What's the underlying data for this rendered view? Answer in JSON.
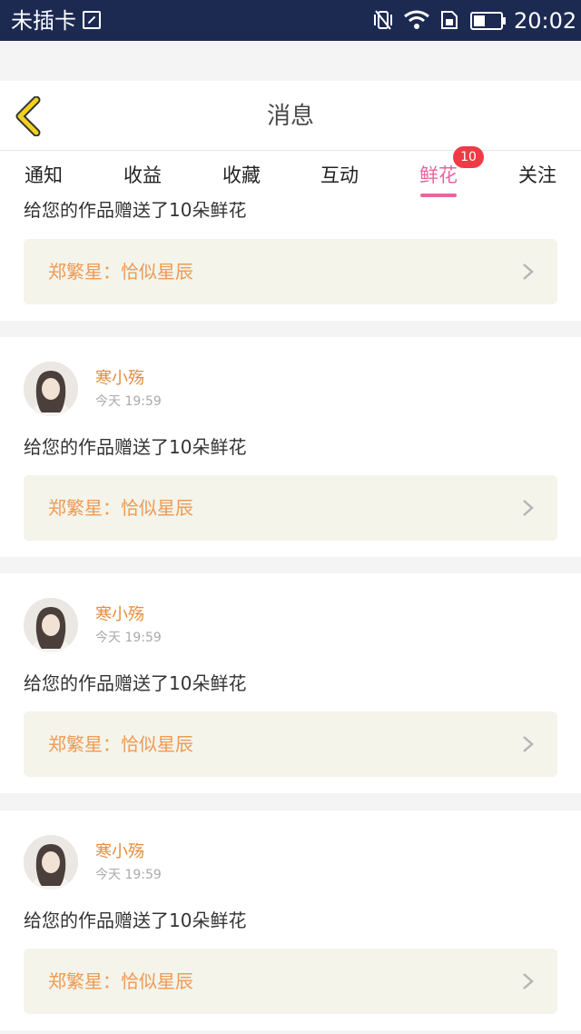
{
  "status_bar": {
    "carrier": "未插卡",
    "time": "20:02"
  },
  "header": {
    "title": "消息",
    "back_icon": "chevron-left-icon"
  },
  "tabs": [
    {
      "label": "通知",
      "active": false
    },
    {
      "label": "收益",
      "active": false
    },
    {
      "label": "收藏",
      "active": false
    },
    {
      "label": "互动",
      "active": false
    },
    {
      "label": "鲜花",
      "active": true,
      "badge": "10"
    },
    {
      "label": "关注",
      "active": false
    }
  ],
  "partial_message": {
    "text": "给您的作品赠送了10朵鲜花",
    "work": "郑繁星：恰似星辰"
  },
  "messages": [
    {
      "sender": "寒小殇",
      "time": "今天 19:59",
      "text": "给您的作品赠送了10朵鲜花",
      "work": "郑繁星：恰似星辰"
    },
    {
      "sender": "寒小殇",
      "time": "今天 19:59",
      "text": "给您的作品赠送了10朵鲜花",
      "work": "郑繁星：恰似星辰"
    },
    {
      "sender": "寒小殇",
      "time": "今天 19:59",
      "text": "给您的作品赠送了10朵鲜花",
      "work": "郑繁星：恰似星辰"
    }
  ],
  "colors": {
    "status_bar": "#1c2a52",
    "accent_pink": "#e8659e",
    "badge_red": "#f03a46",
    "sender_orange": "#e58d3e",
    "back_arrow_yellow": "#f2d21f"
  }
}
